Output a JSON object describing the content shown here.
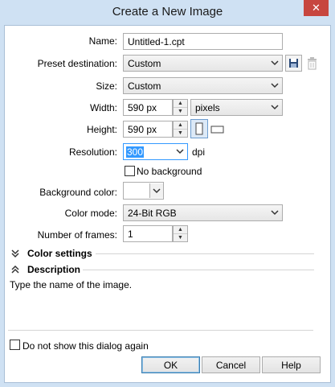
{
  "window": {
    "title": "Create a New Image",
    "close_glyph": "✕"
  },
  "form": {
    "name": {
      "label": "Name:",
      "value": "Untitled-1.cpt"
    },
    "preset": {
      "label": "Preset destination:",
      "value": "Custom"
    },
    "size": {
      "label": "Size:",
      "value": "Custom"
    },
    "width": {
      "label": "Width:",
      "value": "590 px",
      "unit": "pixels"
    },
    "height": {
      "label": "Height:",
      "value": "590 px"
    },
    "resolution": {
      "label": "Resolution:",
      "value": "300",
      "unit": "dpi"
    },
    "no_background": {
      "label": "No background",
      "checked": false
    },
    "background_color": {
      "label": "Background color:",
      "color": "#ffffff"
    },
    "color_mode": {
      "label": "Color mode:",
      "value": "24-Bit RGB"
    },
    "frames": {
      "label": "Number of frames:",
      "value": "1"
    }
  },
  "sections": {
    "color_settings": {
      "label": "Color settings",
      "expanded": false
    },
    "description": {
      "label": "Description",
      "expanded": true,
      "text": "Type the name of the image."
    }
  },
  "footer": {
    "dont_show": {
      "label": "Do not show this dialog again",
      "checked": false
    },
    "ok": "OK",
    "cancel": "Cancel",
    "help": "Help"
  },
  "icons": {
    "save_preset": "save-preset-icon",
    "delete_preset": "trash-icon",
    "portrait": "portrait-orientation-icon",
    "landscape": "landscape-orientation-icon"
  },
  "colors": {
    "accent": "#3399ff",
    "close": "#c7463f",
    "window_frame": "#cfe1f3"
  }
}
